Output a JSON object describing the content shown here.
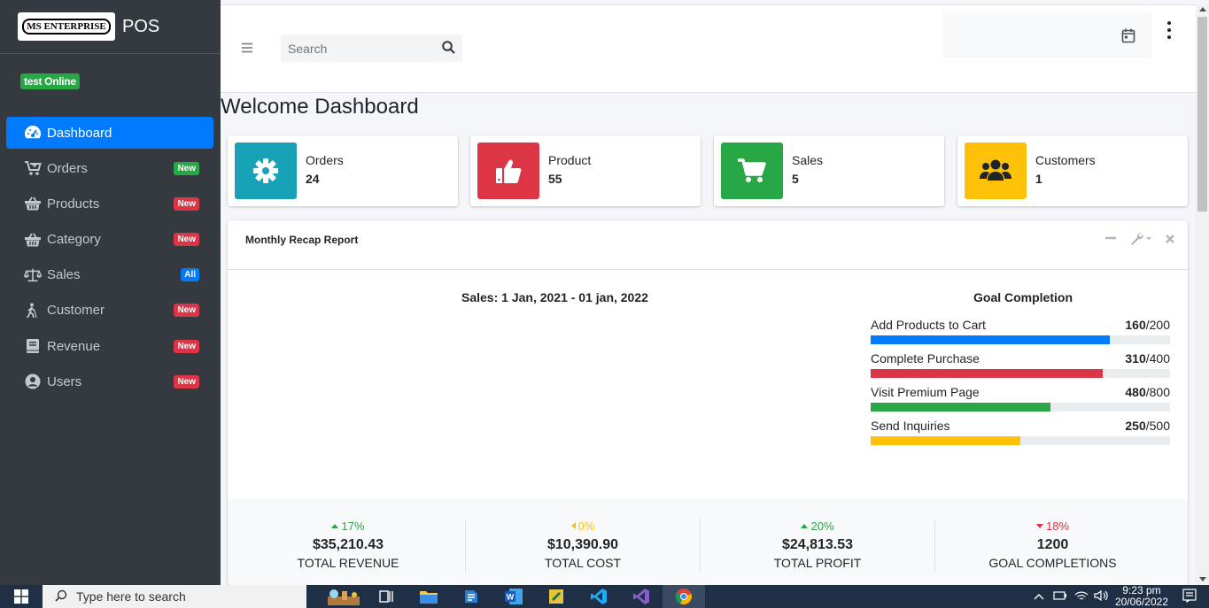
{
  "sidebar": {
    "brand_logo": "MS ENTERPRISE",
    "brand_text": "POS",
    "status": "test Online",
    "items": [
      {
        "label": "Dashboard",
        "badge": "",
        "icon": "dashboard-gauge-icon"
      },
      {
        "label": "Orders",
        "badge": "New",
        "icon": "cart-plus-icon"
      },
      {
        "label": "Products",
        "badge": "New",
        "icon": "basket-icon"
      },
      {
        "label": "Category",
        "badge": "New",
        "icon": "basket-icon"
      },
      {
        "label": "Sales",
        "badge": "All",
        "icon": "balance-scale-icon"
      },
      {
        "label": "Customer",
        "badge": "New",
        "icon": "walking-person-icon"
      },
      {
        "label": "Revenue",
        "badge": "New",
        "icon": "book-icon"
      },
      {
        "label": "Users",
        "badge": "New",
        "icon": "user-circle-icon"
      }
    ]
  },
  "topbar": {
    "search_placeholder": "Search"
  },
  "page": {
    "title": "Welcome Dashboard"
  },
  "info_boxes": [
    {
      "label": "Orders",
      "value": "24",
      "color": "#17a2b8",
      "icon": "gear-icon"
    },
    {
      "label": "Product",
      "value": "55",
      "color": "#dc3545",
      "icon": "thumbs-up-icon"
    },
    {
      "label": "Sales",
      "value": "5",
      "color": "#28a745",
      "icon": "shopping-cart-icon"
    },
    {
      "label": "Customers",
      "value": "1",
      "color": "#ffc107",
      "icon": "users-icon"
    }
  ],
  "report": {
    "title": "Monthly Recap Report",
    "chart_title": "Sales: 1 Jan, 2021 - 01 jan, 2022",
    "goal_title": "Goal Completion",
    "goals": [
      {
        "label": "Add Products to Cart",
        "value": "160",
        "total": "/200",
        "fraction": 0.8,
        "color": "#007bff"
      },
      {
        "label": "Complete Purchase",
        "value": "310",
        "total": "/400",
        "fraction": 0.775,
        "color": "#dc3545"
      },
      {
        "label": "Visit Premium Page",
        "value": "480",
        "total": "/800",
        "fraction": 0.6,
        "color": "#28a745"
      },
      {
        "label": "Send Inquiries",
        "value": "250",
        "total": "/500",
        "fraction": 0.5,
        "color": "#ffc107"
      }
    ],
    "footer": [
      {
        "pct": "17%",
        "trend": "up",
        "amount": "$35,210.43",
        "label": "TOTAL REVENUE"
      },
      {
        "pct": "0%",
        "trend": "left",
        "amount": "$10,390.90",
        "label": "TOTAL COST"
      },
      {
        "pct": "20%",
        "trend": "up",
        "amount": "$24,813.53",
        "label": "TOTAL PROFIT"
      },
      {
        "pct": "18%",
        "trend": "down",
        "amount": "1200",
        "label": "GOAL COMPLETIONS"
      }
    ]
  },
  "taskbar": {
    "search_text": "Type here to search",
    "time": "9:23 pm",
    "date": "20/06/2022"
  }
}
